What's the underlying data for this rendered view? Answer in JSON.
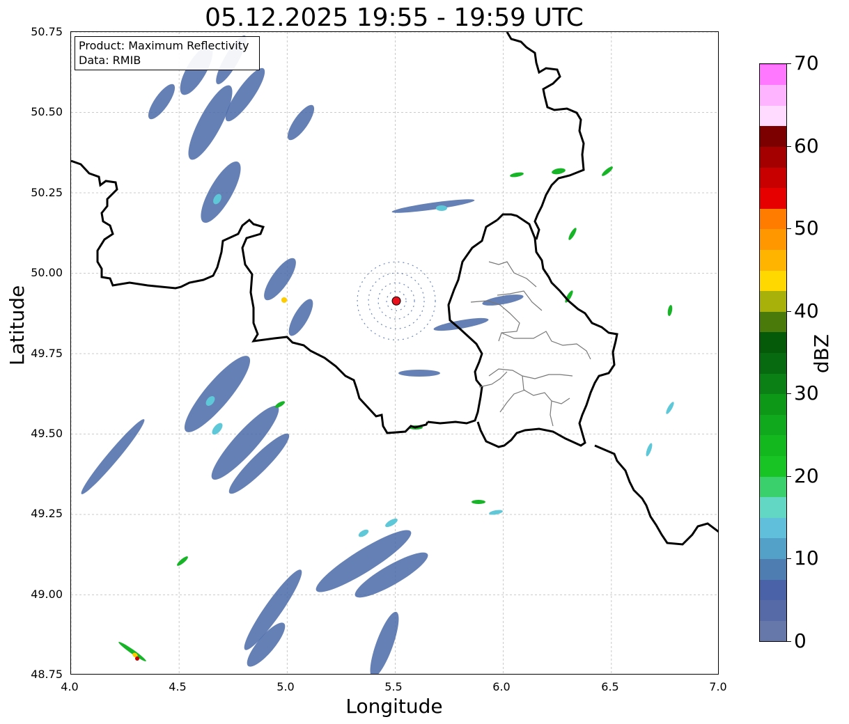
{
  "title": "05.12.2025 19:55 - 19:59 UTC",
  "info_box": {
    "product": "Product: Maximum Reflectivity",
    "data_source": "Data: RMIB"
  },
  "axes": {
    "xlabel": "Longitude",
    "ylabel": "Latitude",
    "xlim": [
      4.0,
      7.0
    ],
    "ylim": [
      48.75,
      50.75
    ],
    "xticks": [
      "4.0",
      "4.5",
      "5.0",
      "5.5",
      "6.0",
      "6.5",
      "7.0"
    ],
    "yticks": [
      "50.75",
      "50.50",
      "50.25",
      "50.00",
      "49.75",
      "49.50",
      "49.25",
      "49.00",
      "48.75"
    ],
    "grid": true
  },
  "radar_site": {
    "lon": 5.505,
    "lat": 49.914,
    "color": "#e8101a"
  },
  "colorbar": {
    "label": "dBZ",
    "range": [
      0,
      70
    ],
    "ticks": [
      "0",
      "10",
      "20",
      "30",
      "40",
      "50",
      "60",
      "70"
    ],
    "step": 2.5,
    "colors": [
      "#6677aa",
      "#556aa6",
      "#4a62a8",
      "#4e7db2",
      "#53a0c8",
      "#60c0dc",
      "#62d8c4",
      "#3ad06c",
      "#18c424",
      "#12b81e",
      "#10a81c",
      "#0e9818",
      "#0b8014",
      "#086a10",
      "#055a0a",
      "#4a7a0a",
      "#a8b00a",
      "#ffd800",
      "#ffb400",
      "#ff9800",
      "#ff7c00",
      "#e60000",
      "#c80000",
      "#a40000",
      "#7c0000",
      "#ffdcff",
      "#ffb4ff",
      "#ff78ff",
      "#f040f0"
    ]
  },
  "echo_colors": {
    "weak": "#4a6aa8",
    "light": "#5ec8d8",
    "moderate": "#18b428",
    "strong": "#ffcc00",
    "intense": "#c80000"
  }
}
